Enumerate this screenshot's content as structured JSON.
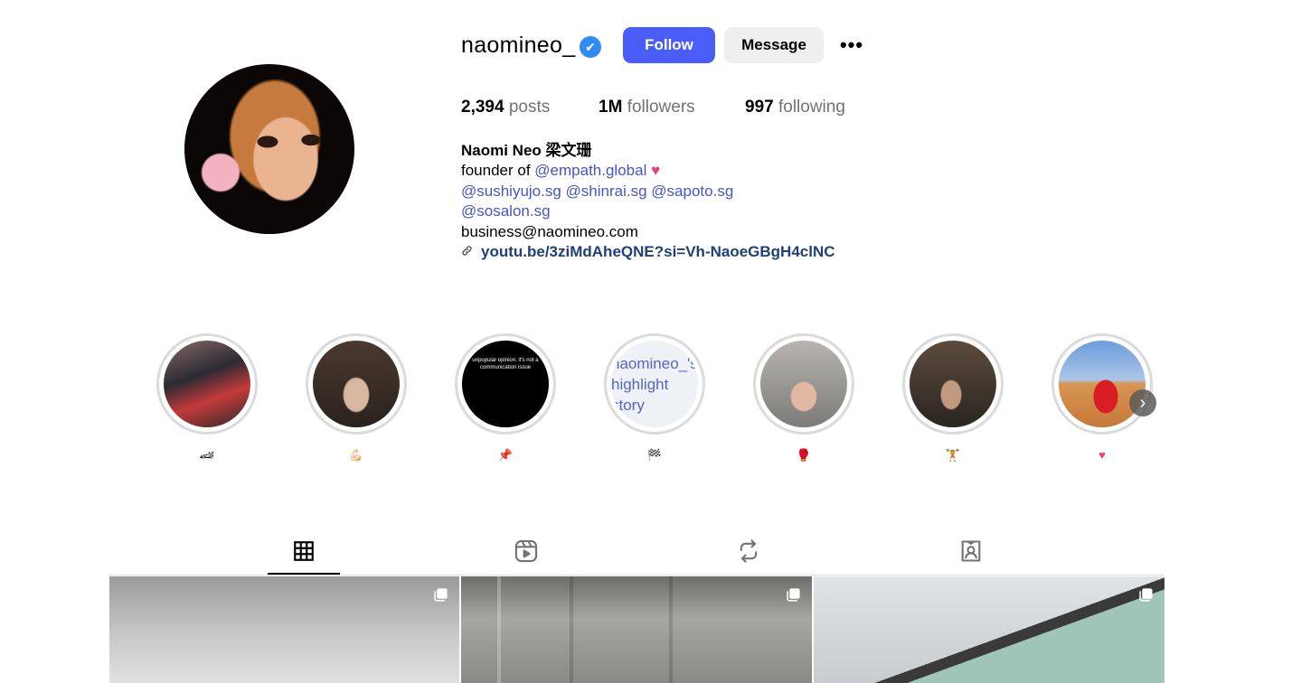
{
  "profile": {
    "username": "naomineo_",
    "verified_icon": "✔",
    "follow_label": "Follow",
    "message_label": "Message",
    "more_label": "•••",
    "posts_count": "2,394",
    "posts_label": "posts",
    "followers_count": "1M",
    "followers_label": "followers",
    "following_count": "997",
    "following_label": "following",
    "full_name": "Naomi Neo 梁文珊",
    "bio_prefix": "founder of",
    "bio_mention_main": "@empath.global",
    "bio_heart": "♥",
    "bio_mentions_line": [
      "@sushiyujo.sg",
      "@shinrai.sg",
      "@sapoto.sg"
    ],
    "bio_mention_salon": "@sosalon.sg",
    "bio_email": "business@naomineo.com",
    "bio_link": "youtu.be/3ziMdAheQNE?si=Vh-NaoeGBgH4clNC"
  },
  "highlights": {
    "items": [
      {
        "label": "🏎"
      },
      {
        "label": "💪🏻"
      },
      {
        "label": "📌"
      },
      {
        "label": "🏁",
        "alt_text": "naomineo_'s highlight story"
      },
      {
        "label": "🥊"
      },
      {
        "label": "🏋"
      },
      {
        "label": "♥"
      }
    ],
    "next_label": "›",
    "story3_text": "unpopular opinion: it's not a communication issue"
  },
  "tabs": [
    {
      "name": "posts",
      "icon": "grid-icon",
      "active": true
    },
    {
      "name": "reels",
      "icon": "reels-icon",
      "active": false
    },
    {
      "name": "reposts",
      "icon": "repost-icon",
      "active": false
    },
    {
      "name": "tagged",
      "icon": "tagged-icon",
      "active": false
    }
  ],
  "colors": {
    "follow_button": "#4a5df9",
    "verified": "#2f8bf5",
    "mention": "#4655c9",
    "heart": "#ec407a"
  }
}
